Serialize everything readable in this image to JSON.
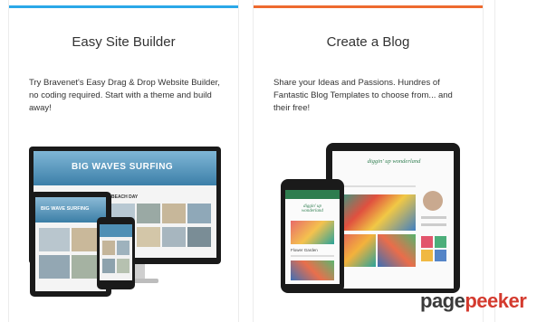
{
  "cards": [
    {
      "title": "Easy Site Builder",
      "description": "Try Bravenet's Easy Drag & Drop Website Builder, no coding required. Start with a theme and build away!",
      "accent": "#2aa8e8",
      "mockup": {
        "banner": "BIG WAVES SURFING",
        "tablet_banner": "BIG WAVE SURFING",
        "small_heading": "BEACH DAY"
      }
    },
    {
      "title": "Create a Blog",
      "description": "Share your Ideas and Passions. Hundres of Fantastic Blog Templates to choose from... and their free!",
      "accent": "#ee6a2f",
      "mockup": {
        "script_title": "diggin' up wonderland",
        "phone_caption": "Flower Garden"
      }
    }
  ],
  "watermark": {
    "part1": "page",
    "part2": "peeker"
  }
}
